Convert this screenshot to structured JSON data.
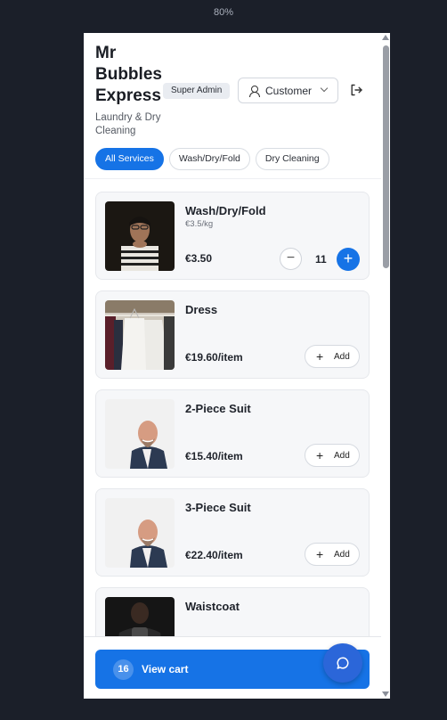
{
  "browser": {
    "zoom": "80%"
  },
  "header": {
    "brand_name": "Mr Bubbles Express",
    "tagline": "Laundry & Dry Cleaning",
    "role_badge": "Super Admin",
    "role_select": {
      "value": "Customer",
      "icon": "user-icon"
    },
    "logout_icon": "logout-icon"
  },
  "filters": [
    {
      "label": "All Services",
      "active": true
    },
    {
      "label": "Wash/Dry/Fold",
      "active": false
    },
    {
      "label": "Dry Cleaning",
      "active": false
    }
  ],
  "services": [
    {
      "name": "Wash/Dry/Fold",
      "unit": "€3.5/kg",
      "price": "€3.50",
      "quantity": "11"
    },
    {
      "name": "Dress",
      "price": "€19.60/item",
      "add_label": "Add"
    },
    {
      "name": "2-Piece Suit",
      "price": "€15.40/item",
      "add_label": "Add"
    },
    {
      "name": "3-Piece Suit",
      "price": "€22.40/item",
      "add_label": "Add"
    },
    {
      "name": "Waistcoat"
    }
  ],
  "cart": {
    "count": "16",
    "label": "View cart"
  },
  "colors": {
    "accent": "#1673e6",
    "fab": "#2b66d9",
    "background": "#1b1f29"
  }
}
